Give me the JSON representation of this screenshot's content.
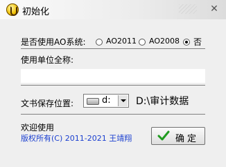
{
  "window": {
    "title": "初始化",
    "close_glyph": "✕"
  },
  "ao_system": {
    "label": "是否使用AO系统:",
    "options": [
      {
        "label": "AO2011",
        "checked": false
      },
      {
        "label": "AO2008",
        "checked": false
      },
      {
        "label": "否",
        "checked": true
      }
    ]
  },
  "unit_name": {
    "label": "使用单位全称:",
    "value": ""
  },
  "doc_save": {
    "label": "文书保存位置:",
    "drive": "d:",
    "path": "D:\\审计数据"
  },
  "footer": {
    "welcome": "欢迎使用",
    "copyright": "版权所有(C) 2011-2021 王靖翔",
    "ok_label": "确定"
  },
  "icons": {
    "app": "app-logo-icon",
    "drive": "hard-drive-icon",
    "ok": "green-check-icon"
  },
  "colors": {
    "copyright_text": "#1a3fd0",
    "check_green": "#1f9b1f"
  }
}
